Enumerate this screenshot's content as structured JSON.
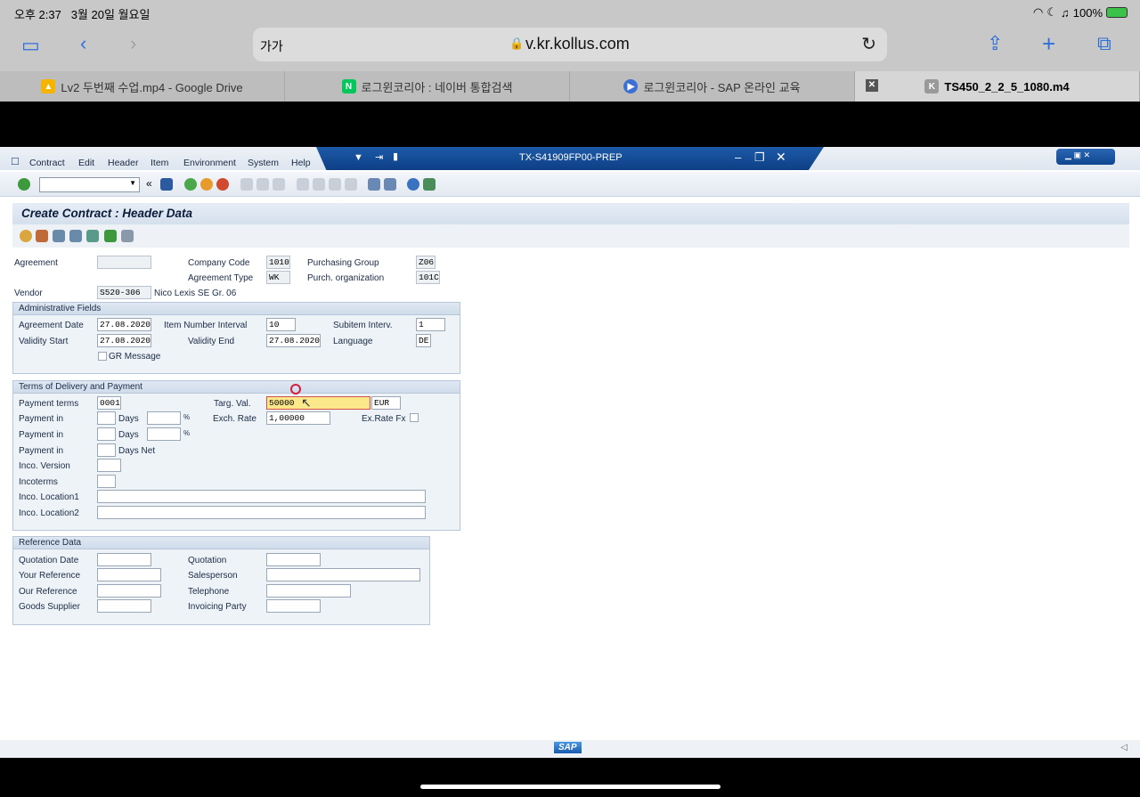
{
  "ios_status": {
    "time": "오후 2:37",
    "date": "3월 20일 월요일",
    "battery": "100%"
  },
  "safari": {
    "text_size": "가가",
    "url": "v.kr.kollus.com"
  },
  "tabs": [
    {
      "label": "Lv2 두번째 수업.mp4 - Google Drive"
    },
    {
      "label": "로그윈코리아 : 네이버 통합검색"
    },
    {
      "label": "로그윈코리아 - SAP 온라인 교육"
    },
    {
      "label": "TS450_2_2_5_1080.m4"
    }
  ],
  "sap": {
    "menu": [
      "Contract",
      "Edit",
      "Header",
      "Item",
      "Environment",
      "System",
      "Help"
    ],
    "system_title": "TX-S41909FP00-PREP",
    "screen_title": "Create Contract : Header Data",
    "header": {
      "agreement_label": "Agreement",
      "agreement_value": "",
      "company_code_label": "Company Code",
      "company_code_value": "1010",
      "purchasing_group_label": "Purchasing Group",
      "purchasing_group_value": "Z06",
      "agreement_type_label": "Agreement Type",
      "agreement_type_value": "WK",
      "purch_org_label": "Purch. organization",
      "purch_org_value": "101C",
      "vendor_label": "Vendor",
      "vendor_value": "S520-306",
      "vendor_name": "Nico Lexis SE Gr. 06"
    },
    "admin": {
      "title": "Administrative Fields",
      "agreement_date_label": "Agreement Date",
      "agreement_date_value": "27.08.2020",
      "item_interval_label": "Item Number Interval",
      "item_interval_value": "10",
      "subitem_label": "Subitem Interv.",
      "subitem_value": "1",
      "validity_start_label": "Validity Start",
      "validity_start_value": "27.08.2020",
      "validity_end_label": "Validity End",
      "validity_end_value": "27.08.2020",
      "language_label": "Language",
      "language_value": "DE",
      "gr_message_label": "GR Message"
    },
    "delivery": {
      "title": "Terms of Delivery and Payment",
      "payment_terms_label": "Payment terms",
      "payment_terms_value": "0001",
      "targ_val_label": "Targ. Val.",
      "targ_val_value": "50000",
      "currency_value": "EUR",
      "payment_in_label": "Payment in",
      "days_label": "Days",
      "pct": "%",
      "exch_rate_label": "Exch. Rate",
      "exch_rate_value": "1,00000",
      "exrate_fx_label": "Ex.Rate Fx",
      "days_net_label": "Days Net",
      "inco_version_label": "Inco. Version",
      "incoterms_label": "Incoterms",
      "inco_loc1_label": "Inco. Location1",
      "inco_loc2_label": "Inco. Location2"
    },
    "reference": {
      "title": "Reference Data",
      "quotation_date_label": "Quotation Date",
      "quotation_label": "Quotation",
      "your_ref_label": "Your Reference",
      "salesperson_label": "Salesperson",
      "our_ref_label": "Our Reference",
      "telephone_label": "Telephone",
      "goods_supplier_label": "Goods Supplier",
      "invoicing_party_label": "Invoicing Party"
    },
    "sap_logo": "SAP"
  }
}
